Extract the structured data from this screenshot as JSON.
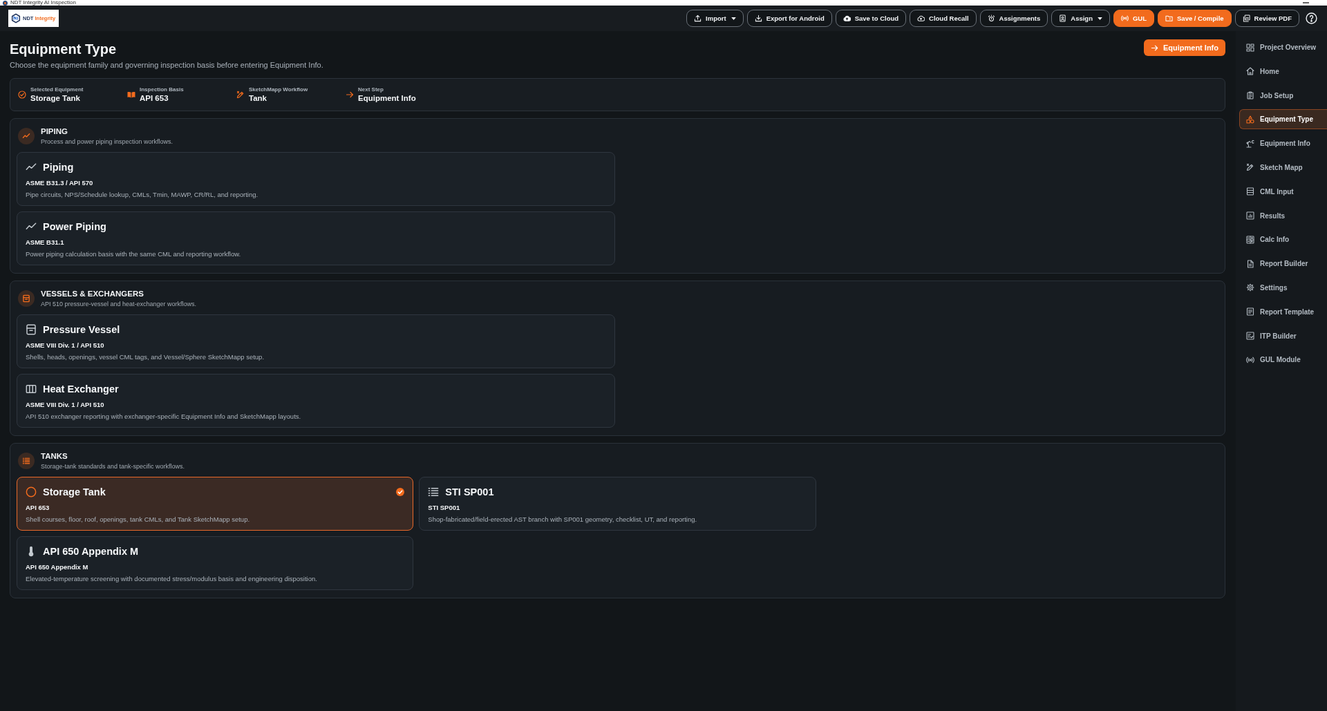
{
  "window": {
    "title": "NDT Integrity AI Inspection"
  },
  "app_bar": {
    "logo": {
      "name": "NDT",
      "accent": "Integrity"
    },
    "buttons": [
      {
        "label": "Import",
        "primary": false,
        "dropdown": true
      },
      {
        "label": "Export for Android",
        "primary": false,
        "dropdown": false
      },
      {
        "label": "Save to Cloud",
        "primary": false,
        "dropdown": false
      },
      {
        "label": "Cloud Recall",
        "primary": false,
        "dropdown": false
      },
      {
        "label": "Assignments",
        "primary": false,
        "dropdown": false
      },
      {
        "label": "Assign",
        "primary": false,
        "dropdown": true
      },
      {
        "label": "GUL",
        "primary": true,
        "dropdown": false
      },
      {
        "label": "Save / Compile",
        "primary": true,
        "dropdown": false
      },
      {
        "label": "Review PDF",
        "primary": false,
        "dropdown": false
      }
    ]
  },
  "page": {
    "title": "Equipment Type",
    "subtitle": "Choose the equipment family and governing inspection basis before entering Equipment Info.",
    "action": "Equipment Info"
  },
  "summary": [
    {
      "label": "Selected Equipment",
      "value": "Storage Tank"
    },
    {
      "label": "Inspection Basis",
      "value": "API 653"
    },
    {
      "label": "SketchMapp Workflow",
      "value": "Tank"
    },
    {
      "label": "Next Step",
      "value": "Equipment Info"
    }
  ],
  "sections": [
    {
      "title": "PIPING",
      "subtitle": "Process and power piping inspection workflows.",
      "items": [
        {
          "name": "Piping",
          "standard": "ASME B31.3 / API 570",
          "description": "Pipe circuits, NPS/Schedule lookup, CMLs, Tmin, MAWP, CR/RL, and reporting.",
          "selected": false
        },
        {
          "name": "Power Piping",
          "standard": "ASME B31.1",
          "description": "Power piping calculation basis with the same CML and reporting workflow.",
          "selected": false
        }
      ]
    },
    {
      "title": "VESSELS & EXCHANGERS",
      "subtitle": "API 510 pressure-vessel and heat-exchanger workflows.",
      "items": [
        {
          "name": "Pressure Vessel",
          "standard": "ASME VIII Div. 1 / API 510",
          "description": "Shells, heads, openings, vessel CML tags, and Vessel/Sphere SketchMapp setup.",
          "selected": false
        },
        {
          "name": "Heat Exchanger",
          "standard": "ASME VIII Div. 1 / API 510",
          "description": "API 510 exchanger reporting with exchanger-specific Equipment Info and SketchMapp layouts.",
          "selected": false
        }
      ]
    },
    {
      "title": "TANKS",
      "subtitle": "Storage-tank standards and tank-specific workflows.",
      "items": [
        {
          "name": "Storage Tank",
          "standard": "API 653",
          "description": "Shell courses, floor, roof, openings, tank CMLs, and Tank SketchMapp setup.",
          "selected": true
        },
        {
          "name": "STI SP001",
          "standard": "STI SP001",
          "description": "Shop-fabricated/field-erected AST branch with SP001 geometry, checklist, UT, and reporting.",
          "selected": false
        },
        {
          "name": "API 650 Appendix M",
          "standard": "API 650 Appendix M",
          "description": "Elevated-temperature screening with documented stress/modulus basis and engineering disposition.",
          "selected": false
        }
      ]
    }
  ],
  "sidebar": {
    "items": [
      {
        "label": "Project Overview",
        "selected": false
      },
      {
        "label": "Home",
        "selected": false
      },
      {
        "label": "Job Setup",
        "selected": false
      },
      {
        "label": "Equipment Type",
        "selected": true
      },
      {
        "label": "Equipment Info",
        "selected": false
      },
      {
        "label": "Sketch Mapp",
        "selected": false
      },
      {
        "label": "CML Input",
        "selected": false
      },
      {
        "label": "Results",
        "selected": false
      },
      {
        "label": "Calc Info",
        "selected": false
      },
      {
        "label": "Report Builder",
        "selected": false
      },
      {
        "label": "Settings",
        "selected": false
      },
      {
        "label": "Report Template",
        "selected": false
      },
      {
        "label": "ITP Builder",
        "selected": false
      },
      {
        "label": "GUL Module",
        "selected": false
      }
    ]
  }
}
